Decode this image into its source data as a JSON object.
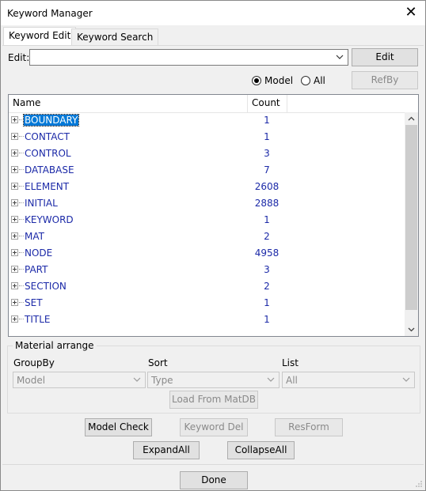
{
  "window": {
    "title": "Keyword Manager"
  },
  "tabs": [
    {
      "label": "Keyword Edit",
      "active": true
    },
    {
      "label": "Keyword Search",
      "active": false
    }
  ],
  "edit": {
    "label": "Edit:",
    "value": "",
    "button": "Edit"
  },
  "filter": {
    "model_label": "Model",
    "all_label": "All",
    "selected": "Model",
    "refby_button": "RefBy"
  },
  "tree": {
    "columns": [
      "Name",
      "Count"
    ],
    "rows": [
      {
        "name": "BOUNDARY",
        "count": "1"
      },
      {
        "name": "CONTACT",
        "count": "1"
      },
      {
        "name": "CONTROL",
        "count": "3"
      },
      {
        "name": "DATABASE",
        "count": "7"
      },
      {
        "name": "ELEMENT",
        "count": "2608"
      },
      {
        "name": "INITIAL",
        "count": "2888"
      },
      {
        "name": "KEYWORD",
        "count": "1"
      },
      {
        "name": "MAT",
        "count": "2"
      },
      {
        "name": "NODE",
        "count": "4958"
      },
      {
        "name": "PART",
        "count": "3"
      },
      {
        "name": "SECTION",
        "count": "2"
      },
      {
        "name": "SET",
        "count": "1"
      },
      {
        "name": "TITLE",
        "count": "1"
      }
    ],
    "selected": "BOUNDARY"
  },
  "material": {
    "title": "Material arrange",
    "groupby_label": "GroupBy",
    "groupby_value": "Model",
    "sort_label": "Sort",
    "sort_value": "Type",
    "list_label": "List",
    "list_value": "All",
    "load_button": "Load From MatDB"
  },
  "actions": {
    "model_check": "Model Check",
    "keyword_del": "Keyword Del",
    "resform": "ResForm",
    "expand_all": "ExpandAll",
    "collapse_all": "CollapseAll",
    "done": "Done"
  },
  "colors": {
    "link_text": "#1c2aa8",
    "selection": "#0078d7"
  }
}
